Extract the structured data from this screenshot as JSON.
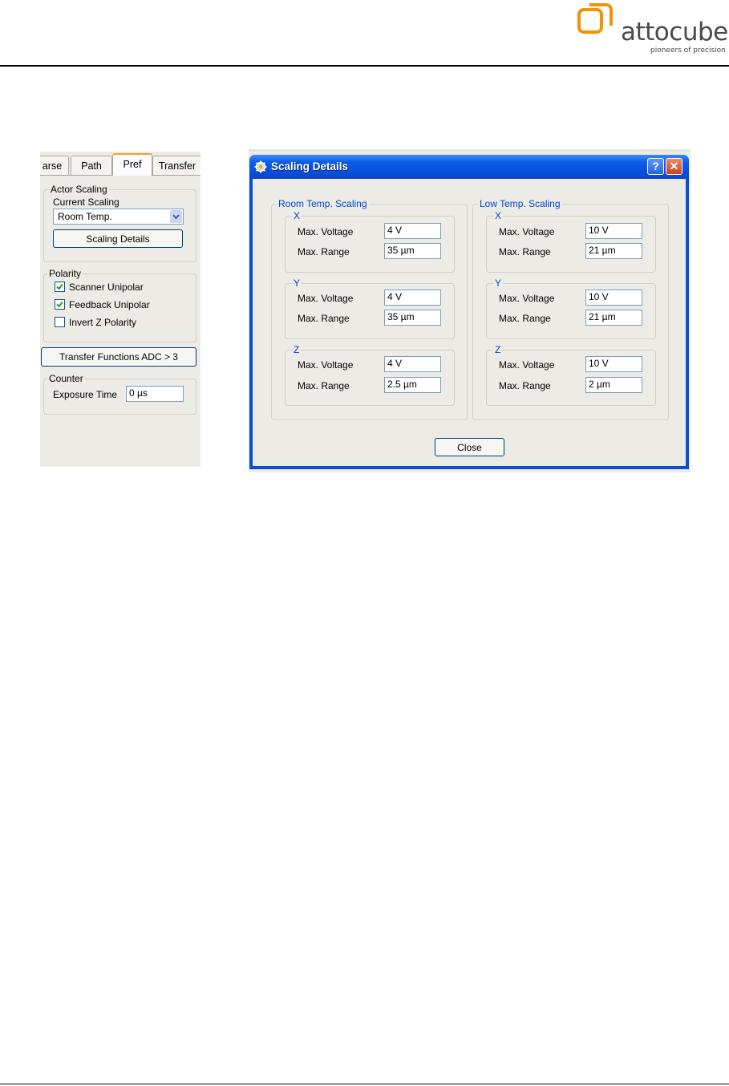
{
  "brand": {
    "name": "attocube",
    "tagline": "pioneers of precision",
    "accent_color": "#f29400"
  },
  "left_panel": {
    "tabs": [
      {
        "label": "arse",
        "active": false
      },
      {
        "label": "Path",
        "active": false
      },
      {
        "label": "Pref",
        "active": true
      },
      {
        "label": "Transfer",
        "active": false
      }
    ],
    "actor_scaling": {
      "title": "Actor Scaling",
      "current_scaling_label": "Current Scaling",
      "current_scaling_value": "Room Temp.",
      "details_button": "Scaling Details"
    },
    "polarity": {
      "title": "Polarity",
      "options": [
        {
          "label": "Scanner Unipolar",
          "checked": true
        },
        {
          "label": "Feedback Unipolar",
          "checked": true
        },
        {
          "label": "Invert Z Polarity",
          "checked": false
        }
      ]
    },
    "transfer_button": "Transfer Functions ADC > 3",
    "counter": {
      "title": "Counter",
      "exposure_label": "Exposure Time",
      "exposure_value": "0 µs"
    }
  },
  "dialog": {
    "title": "Scaling Details",
    "help_glyph": "?",
    "close_glyph": "✕",
    "room": {
      "title": "Room Temp. Scaling",
      "axes": [
        {
          "name": "X",
          "voltage_label": "Max. Voltage",
          "voltage": "4 V",
          "range_label": "Max. Range",
          "range": "35 µm"
        },
        {
          "name": "Y",
          "voltage_label": "Max. Voltage",
          "voltage": "4 V",
          "range_label": "Max. Range",
          "range": "35 µm"
        },
        {
          "name": "Z",
          "voltage_label": "Max. Voltage",
          "voltage": "4 V",
          "range_label": "Max. Range",
          "range": "2.5 µm"
        }
      ]
    },
    "low": {
      "title": "Low Temp. Scaling",
      "axes": [
        {
          "name": "X",
          "voltage_label": "Max. Voltage",
          "voltage": "10 V",
          "range_label": "Max. Range",
          "range": "21 µm"
        },
        {
          "name": "Y",
          "voltage_label": "Max. Voltage",
          "voltage": "10 V",
          "range_label": "Max. Range",
          "range": "21 µm"
        },
        {
          "name": "Z",
          "voltage_label": "Max. Voltage",
          "voltage": "10 V",
          "range_label": "Max. Range",
          "range": "2 µm"
        }
      ]
    },
    "close_button": "Close"
  }
}
